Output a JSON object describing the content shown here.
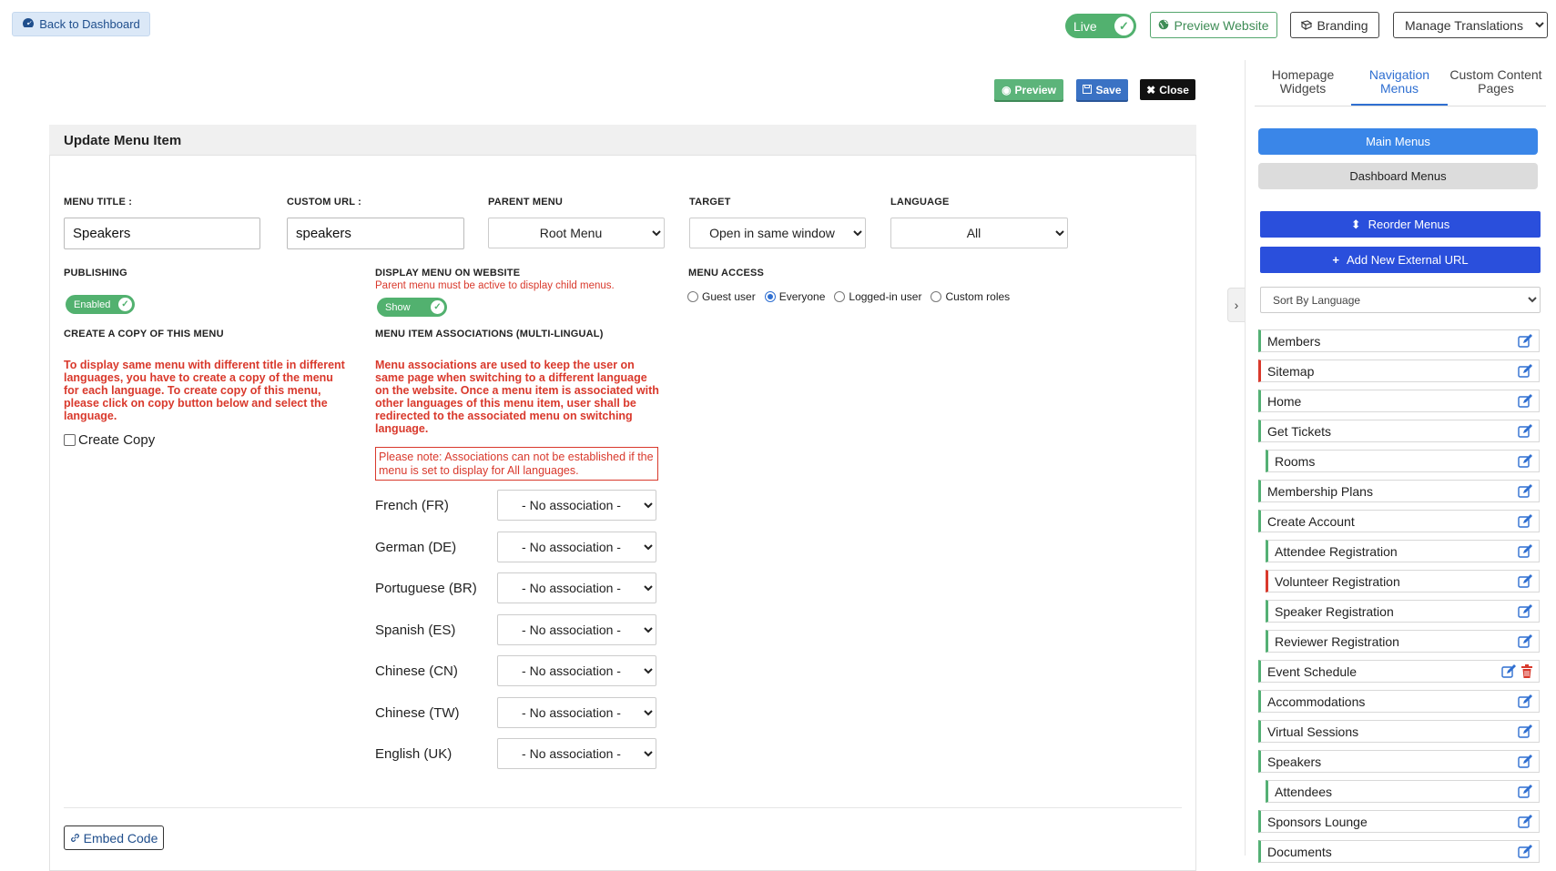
{
  "topbar": {
    "back_label": "Back to Dashboard",
    "live_label": "Live",
    "preview_website_label": "Preview Website",
    "branding_label": "Branding",
    "translations_label": "Manage Translations"
  },
  "actions": {
    "preview_label": "Preview",
    "save_label": "Save",
    "close_label": "Close"
  },
  "form": {
    "panel_title": "Update Menu Item",
    "menu_title_label": "MENU TITLE :",
    "menu_title_value": "Speakers",
    "custom_url_label": "CUSTOM URL :",
    "custom_url_value": "speakers",
    "parent_menu_label": "PARENT MENU",
    "parent_menu_value": "Root Menu",
    "target_label": "TARGET",
    "target_value": "Open in same window",
    "language_label": "LANGUAGE",
    "language_value": "All",
    "publishing_label": "PUBLISHING",
    "publishing_toggle": "Enabled",
    "display_label": "DISPLAY MENU ON WEBSITE",
    "display_hint": "Parent menu must be active to display child menus.",
    "display_toggle": "Show",
    "access_label": "MENU ACCESS",
    "access_options": [
      "Guest user",
      "Everyone",
      "Logged-in user",
      "Custom roles"
    ],
    "access_selected": "Everyone",
    "copy_label": "CREATE A COPY OF THIS MENU",
    "copy_text": "To display same menu with different title in different languages, you have to create a copy of the menu for each language. To create copy of this menu, please click on copy button below and select the language.",
    "create_copy_label": "Create Copy",
    "assoc_label": "MENU ITEM ASSOCIATIONS (MULTI-LINGUAL)",
    "assoc_text": "Menu associations are used to keep the user on same page when switching to a different language on the website. Once a menu item is associated with other languages of this menu item, user shall be redirected to the associated menu on switching language.",
    "assoc_note": "Please note: Associations can not be established if the menu is set to display for All languages.",
    "associations": [
      {
        "language": "French (FR)",
        "value": "- No association -"
      },
      {
        "language": "German (DE)",
        "value": "- No association -"
      },
      {
        "language": "Portuguese (BR)",
        "value": "- No association -"
      },
      {
        "language": "Spanish (ES)",
        "value": "- No association -"
      },
      {
        "language": "Chinese (CN)",
        "value": "- No association -"
      },
      {
        "language": "Chinese (TW)",
        "value": "- No association -"
      },
      {
        "language": "English (UK)",
        "value": "- No association -"
      }
    ],
    "embed_label": "Embed Code"
  },
  "sidebar": {
    "tabs": [
      "Homepage Widgets",
      "Navigation Menus",
      "Custom Content Pages"
    ],
    "active_tab": "Navigation Menus",
    "main_menus_label": "Main Menus",
    "dashboard_menus_label": "Dashboard Menus",
    "reorder_label": "Reorder Menus",
    "add_url_label": "Add New External URL",
    "sort_label": "Sort By Language",
    "menu_items": [
      {
        "label": "Members",
        "child": false,
        "status": "green"
      },
      {
        "label": "Sitemap",
        "child": false,
        "status": "red"
      },
      {
        "label": "Home",
        "child": false,
        "status": "green"
      },
      {
        "label": "Get Tickets",
        "child": false,
        "status": "green"
      },
      {
        "label": "Rooms",
        "child": true,
        "status": "green"
      },
      {
        "label": "Membership Plans",
        "child": false,
        "status": "green"
      },
      {
        "label": "Create Account",
        "child": false,
        "status": "green"
      },
      {
        "label": "Attendee Registration",
        "child": true,
        "status": "green"
      },
      {
        "label": "Volunteer Registration",
        "child": true,
        "status": "red"
      },
      {
        "label": "Speaker Registration",
        "child": true,
        "status": "green"
      },
      {
        "label": "Reviewer Registration",
        "child": true,
        "status": "green"
      },
      {
        "label": "Event Schedule",
        "child": false,
        "status": "green",
        "deletable": true
      },
      {
        "label": "Accommodations",
        "child": false,
        "status": "green"
      },
      {
        "label": "Virtual Sessions",
        "child": false,
        "status": "green"
      },
      {
        "label": "Speakers",
        "child": false,
        "status": "green"
      },
      {
        "label": "Attendees",
        "child": true,
        "status": "green"
      },
      {
        "label": "Sponsors Lounge",
        "child": false,
        "status": "green"
      },
      {
        "label": "Documents",
        "child": false,
        "status": "green"
      }
    ]
  }
}
